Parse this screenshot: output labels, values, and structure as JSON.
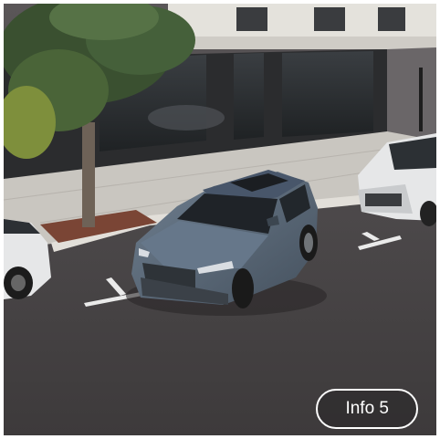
{
  "card": {
    "info_label": "Info 5"
  },
  "colors": {
    "asphalt": "#4a4748",
    "sidewalk": "#c9c6c0",
    "building_dark": "#2b2c2e",
    "suv_body": "#5b6a7a",
    "car_white": "#e6e7e8",
    "button_border": "#ffffff"
  }
}
